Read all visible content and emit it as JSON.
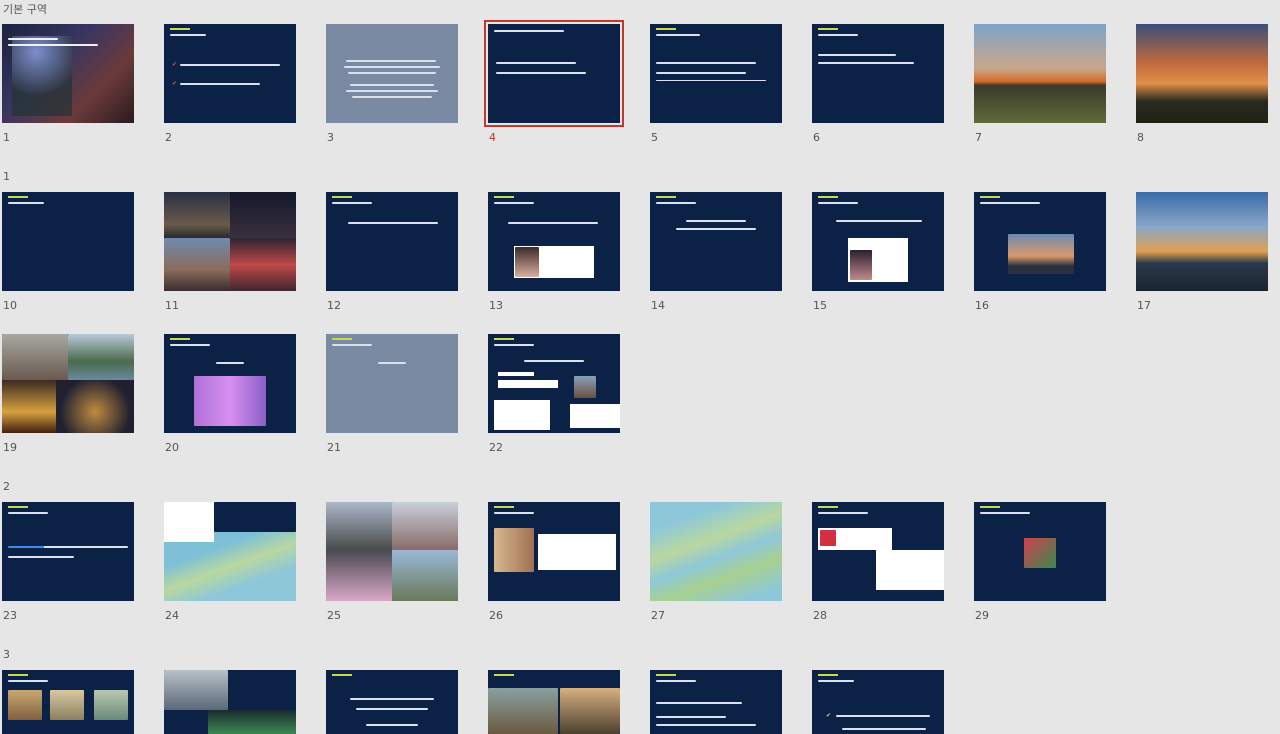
{
  "sections": [
    {
      "label": "기본 구역"
    },
    {
      "label": "1"
    },
    {
      "label": "2"
    },
    {
      "label": "3"
    }
  ],
  "slides": [
    {
      "n": "1"
    },
    {
      "n": "2"
    },
    {
      "n": "3"
    },
    {
      "n": "4"
    },
    {
      "n": "5"
    },
    {
      "n": "6"
    },
    {
      "n": "7"
    },
    {
      "n": "8"
    },
    {
      "n": "10"
    },
    {
      "n": "11"
    },
    {
      "n": "12"
    },
    {
      "n": "13"
    },
    {
      "n": "14"
    },
    {
      "n": "15"
    },
    {
      "n": "16"
    },
    {
      "n": "17"
    },
    {
      "n": "19"
    },
    {
      "n": "20"
    },
    {
      "n": "21"
    },
    {
      "n": "22"
    },
    {
      "n": "23"
    },
    {
      "n": "24"
    },
    {
      "n": "25"
    },
    {
      "n": "26"
    },
    {
      "n": "27"
    },
    {
      "n": "28"
    },
    {
      "n": "29"
    }
  ],
  "colors": {
    "background": "#e6e6e6",
    "slide_navy": "#0b2246",
    "slide_gray": "#7b8aa3",
    "selection": "#c0392b"
  }
}
